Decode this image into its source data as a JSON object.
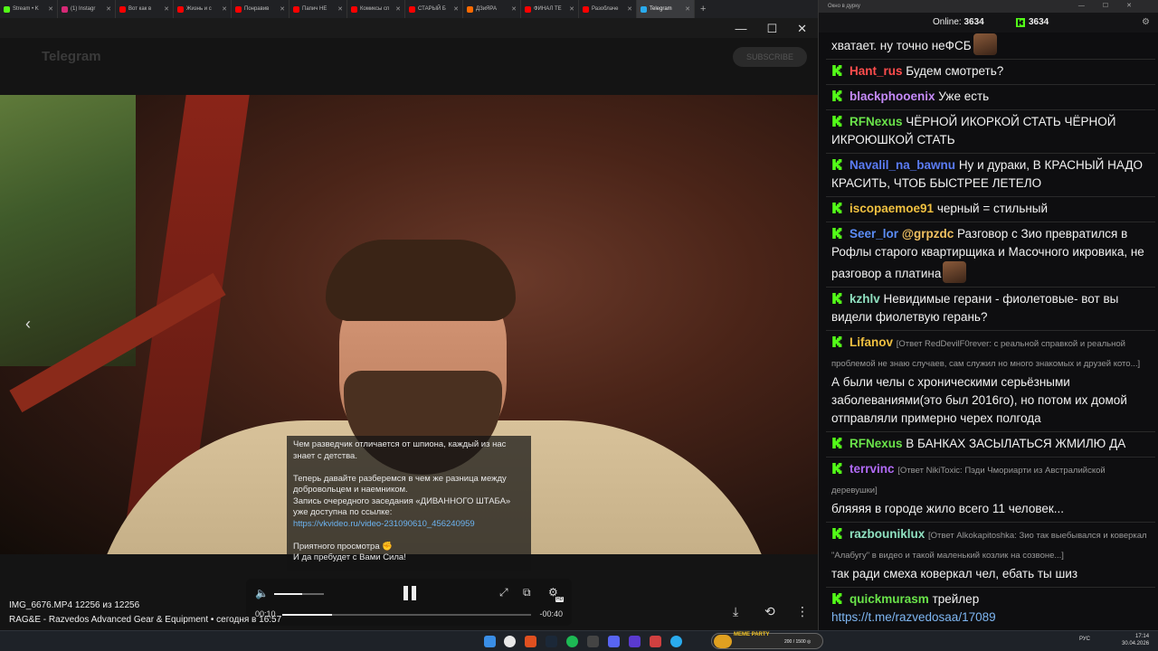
{
  "browser": {
    "tabs": [
      {
        "label": "Stream • K",
        "color": "#53fc18",
        "active": false
      },
      {
        "label": "(1) Instagr",
        "color": "#d62976",
        "active": false
      },
      {
        "label": "Вот как в",
        "color": "#ff0000",
        "active": false
      },
      {
        "label": "Жизнь и с",
        "color": "#ff0000",
        "active": false
      },
      {
        "label": "Понравив",
        "color": "#ff0000",
        "active": false
      },
      {
        "label": "Папич НЕ",
        "color": "#ff0000",
        "active": false
      },
      {
        "label": "Комиксы сп",
        "color": "#ff0000",
        "active": false
      },
      {
        "label": "СТАРЫЙ Б",
        "color": "#ff0000",
        "active": false
      },
      {
        "label": "ДЗиЯРА",
        "color": "#ff6a00",
        "active": false
      },
      {
        "label": "ФИНАЛ ТЕ",
        "color": "#ff0000",
        "active": false
      },
      {
        "label": "Разоблаче",
        "color": "#ff0000",
        "active": false
      },
      {
        "label": "Telegram",
        "color": "#2aabee",
        "active": true
      }
    ],
    "new_tab": "+",
    "window_controls": [
      "—",
      "☐",
      "✕"
    ]
  },
  "telegram": {
    "title": "Telegram",
    "header_button": "SUBSCRIBE"
  },
  "viewer": {
    "prev_arrow": "‹",
    "caption": {
      "p1": "Чем разведчик отличается от шпиона, каждый из нас знает с детства.",
      "p2a": "Теперь давайте разберемся в чем же разница между добровольцем и наемником.",
      "p2b": "Запись очередного заседания «ДИВАННОГО ШТАБА» уже доступна по ссылке:",
      "link": "https://vkvideo.ru/video-231090610_456240959",
      "p3a": "Приятного просмотра ✊",
      "p3b": "И да пребудет с Вами Сила!"
    },
    "controls": {
      "volume_icon": "🔈",
      "volume_level": 0.56,
      "time_current": "00:10",
      "time_remaining": "-00:40",
      "progress": 0.2,
      "fullscreen_icon": "⤢",
      "pip_icon": "⧉",
      "settings_icon": "⚙",
      "hd_badge": "HD"
    },
    "file_line": "IMG_6676.MP4 12256 из 12256",
    "source_line": "RAG&E - Razvedos Advanced Gear & Equipment • сегодня в 16:57",
    "download_icon": "⤓",
    "rotate_icon": "⟲",
    "more_icon": "⋮"
  },
  "chat": {
    "window_title": "Окно в дурку",
    "online_label": "Online:",
    "online_count": "3634",
    "viewers_count": "3634",
    "messages": [
      {
        "user": "",
        "color": "#f2f2f2",
        "reply": "",
        "text": "хватает. ну точно неФСБ",
        "emote": true,
        "at": "",
        "link": ""
      },
      {
        "user": "Hant_rus",
        "color": "#ff4d4d",
        "reply": "",
        "text": "Будем смотреть?",
        "emote": false,
        "at": "",
        "link": ""
      },
      {
        "user": "blackphooenix",
        "color": "#c58af9",
        "reply": "",
        "text": "Уже есть",
        "emote": false,
        "at": "",
        "link": ""
      },
      {
        "user": "RFNexus",
        "color": "#6ae34a",
        "reply": "",
        "text": "ЧЁРНОЙ ИКОРКОЙ СТАТЬ ЧЁРНОЙ ИКРОЮШКОЙ СТАТЬ",
        "emote": false,
        "at": "",
        "link": ""
      },
      {
        "user": "Navalil_na_bawnu",
        "color": "#5b7cf5",
        "reply": "",
        "text": "Ну и дураки, В КРАСНЫЙ НАДО КРАСИТЬ, ЧТОБ БЫСТРЕЕ ЛЕТЕЛО",
        "emote": false,
        "at": "",
        "link": ""
      },
      {
        "user": "iscopaemoe91",
        "color": "#f0c040",
        "reply": "",
        "text": "черный = стильный",
        "emote": false,
        "at": "",
        "link": ""
      },
      {
        "user": "Seer_lor",
        "color": "#5b8cf5",
        "reply": "",
        "text": "Разговор с Зио превратился в Рофлы старого квартирщика и Масочного икровика, не разговор а платина",
        "emote": true,
        "at": "@grpzdc",
        "link": ""
      },
      {
        "user": "kzhlv",
        "color": "#8fe0c0",
        "reply": "",
        "text": "Невидимые герани - фиолетовые- вот вы видели фиолетвую герань?",
        "emote": false,
        "at": "",
        "link": ""
      },
      {
        "user": "Lifanov",
        "color": "#f0c040",
        "reply": "[Ответ RedDevilF0rever: с реальной справкой и реальной проблемой не знаю случаев, сам служил но много знакомых и друзей кото...]",
        "text": "А были челы с хроническими серьёзными заболеваниями(это был 2016го), но потом их домой отправляли примерно черех полгода",
        "emote": false,
        "at": "",
        "link": ""
      },
      {
        "user": "RFNexus",
        "color": "#6ae34a",
        "reply": "",
        "text": "В БАНКАХ ЗАСЫЛАТЬСЯ ЖМИЛЮ ДА",
        "emote": false,
        "at": "",
        "link": ""
      },
      {
        "user": "terrvinc",
        "color": "#b06af5",
        "reply": "[Ответ NikiToxic: Пэди Чмориарти из Австралийской деревушки]",
        "text": "бляяяя в городе жило всего 11 человек...",
        "emote": false,
        "at": "",
        "link": ""
      },
      {
        "user": "razbouniklux",
        "color": "#8fe0c0",
        "reply": "[Ответ Alkokapitoshka: Зио так выебывался и коверкал \"Алабугу\" в видео и такой маленький козлик на созвоне...]",
        "text": "так ради смеха коверкал чел, ебать ты шиз",
        "emote": false,
        "at": "",
        "link": ""
      },
      {
        "user": "quickmurasm",
        "color": "#6ae34a",
        "reply": "",
        "text": "трейлер",
        "emote": false,
        "at": "",
        "link": "https://t.me/razvedosaa/17089"
      }
    ]
  },
  "taskbar": {
    "meme_title": "MEME PARTY",
    "meme_count": "200 / 1500 ◎",
    "lang": "РУС",
    "time": "17:14",
    "date": "30.04.2026"
  }
}
